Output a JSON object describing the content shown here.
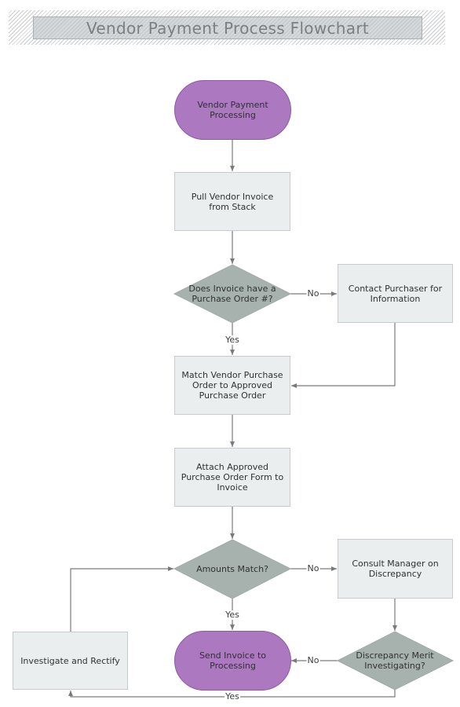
{
  "title": "Vendor Payment Process Flowchart",
  "colors": {
    "terminal_fill": "#ac78c0",
    "process_fill": "#ebeeef",
    "decision_fill": "#a7b2ae",
    "connector": "#7a7a7a"
  },
  "nodes": {
    "start": {
      "type": "terminal",
      "label": "Vendor Payment Processing"
    },
    "pull_invoice": {
      "type": "process",
      "label": "Pull Vendor Invoice from Stack"
    },
    "has_po": {
      "type": "decision",
      "label": "Does Invoice have a Purchase Order #?"
    },
    "contact_purchaser": {
      "type": "process",
      "label": "Contact Purchaser for Information"
    },
    "match_po": {
      "type": "process",
      "label": "Match Vendor Purchase Order to Approved Purchase Order"
    },
    "attach_po": {
      "type": "process",
      "label": "Attach Approved Purchase Order Form to Invoice"
    },
    "amounts_match": {
      "type": "decision",
      "label": "Amounts Match?"
    },
    "consult_manager": {
      "type": "process",
      "label": "Consult Manager on Discrepancy"
    },
    "discrepancy_merit": {
      "type": "decision",
      "label": "Discrepancy Merit Investigating?"
    },
    "send_invoice": {
      "type": "terminal",
      "label": "Send Invoice to Processing"
    },
    "investigate": {
      "type": "process",
      "label": "Investigate and Rectify"
    }
  },
  "edges": [
    {
      "from": "start",
      "to": "pull_invoice",
      "label": ""
    },
    {
      "from": "pull_invoice",
      "to": "has_po",
      "label": ""
    },
    {
      "from": "has_po",
      "to": "contact_purchaser",
      "label": "No"
    },
    {
      "from": "has_po",
      "to": "match_po",
      "label": "Yes"
    },
    {
      "from": "contact_purchaser",
      "to": "match_po",
      "label": ""
    },
    {
      "from": "match_po",
      "to": "attach_po",
      "label": ""
    },
    {
      "from": "attach_po",
      "to": "amounts_match",
      "label": ""
    },
    {
      "from": "amounts_match",
      "to": "consult_manager",
      "label": "No"
    },
    {
      "from": "amounts_match",
      "to": "send_invoice",
      "label": "Yes"
    },
    {
      "from": "consult_manager",
      "to": "discrepancy_merit",
      "label": ""
    },
    {
      "from": "discrepancy_merit",
      "to": "send_invoice",
      "label": "No"
    },
    {
      "from": "discrepancy_merit",
      "to": "investigate",
      "label": "Yes"
    },
    {
      "from": "investigate",
      "to": "amounts_match",
      "label": ""
    }
  ],
  "edge_labels": {
    "has_po_no": "No",
    "has_po_yes": "Yes",
    "amounts_no": "No",
    "amounts_yes": "Yes",
    "merit_no": "No",
    "merit_yes": "Yes"
  }
}
